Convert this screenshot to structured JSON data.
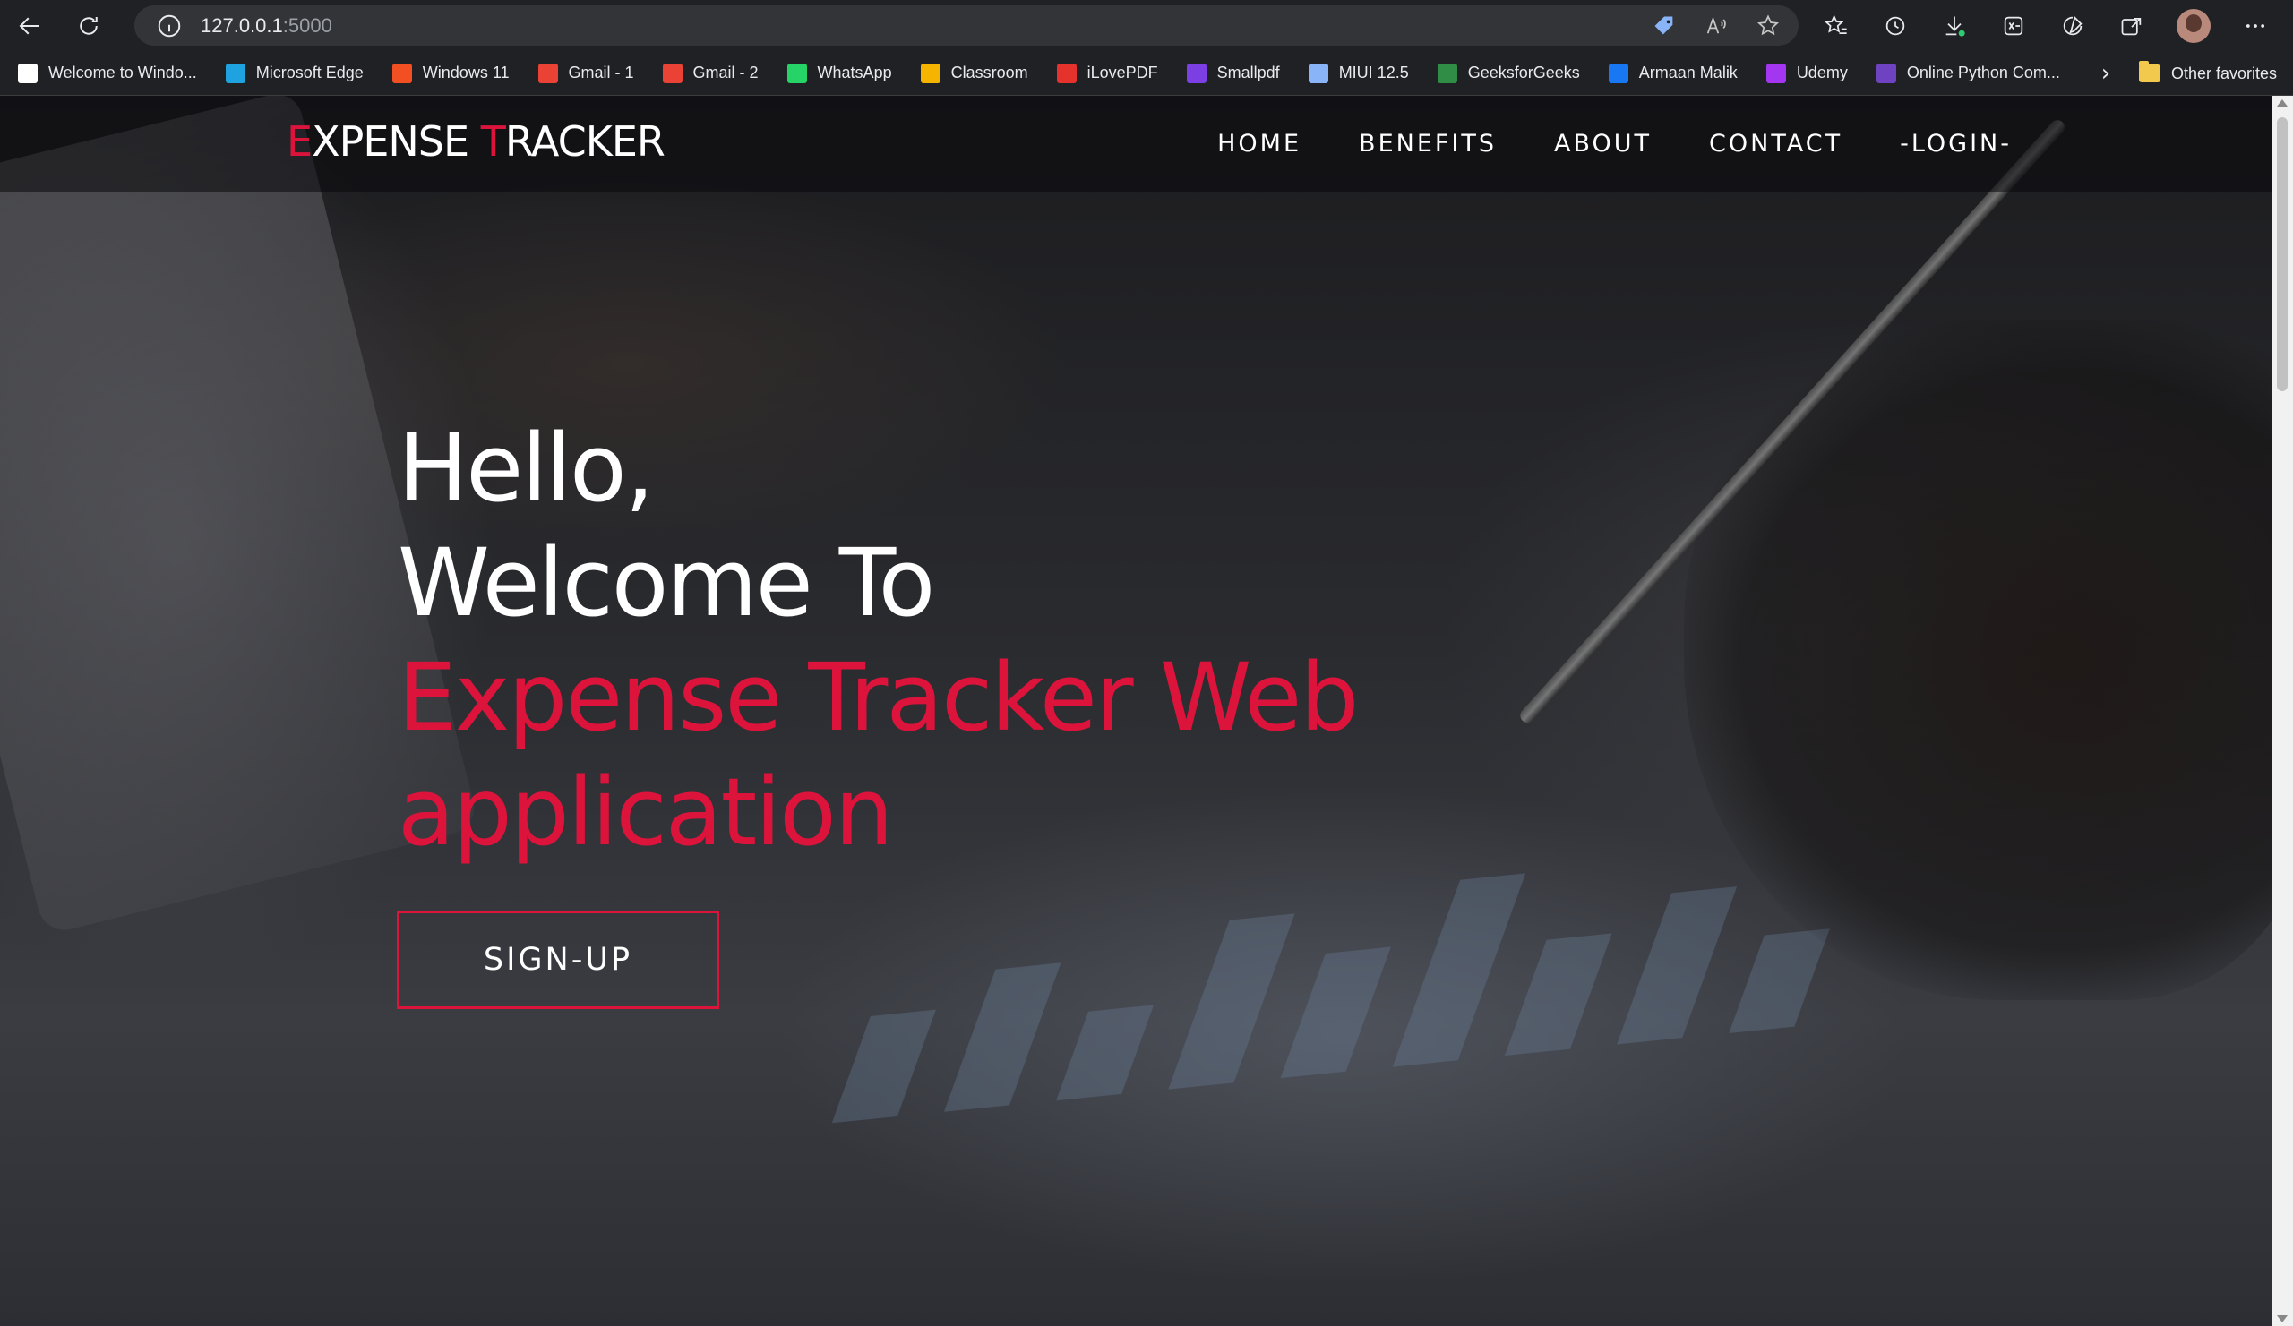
{
  "browser": {
    "url_host": "127.0.0.1",
    "url_port": ":5000",
    "bookmarks": [
      {
        "label": "Welcome to Windo...",
        "icon": "window-icon",
        "color": "#ffffff"
      },
      {
        "label": "Microsoft Edge",
        "icon": "edge-icon",
        "color": "#1fa2e0"
      },
      {
        "label": "Windows 11",
        "icon": "windows-icon",
        "color": "#f25022"
      },
      {
        "label": "Gmail - 1",
        "icon": "gmail-icon",
        "color": "#ea4335"
      },
      {
        "label": "Gmail - 2",
        "icon": "gmail-icon",
        "color": "#ea4335"
      },
      {
        "label": "WhatsApp",
        "icon": "whatsapp-icon",
        "color": "#25d366"
      },
      {
        "label": "Classroom",
        "icon": "classroom-icon",
        "color": "#f4b400"
      },
      {
        "label": "iLovePDF",
        "icon": "ilovepdf-icon",
        "color": "#e5322d"
      },
      {
        "label": "Smallpdf",
        "icon": "smallpdf-icon",
        "color": "#7b3fe4"
      },
      {
        "label": "MIUI 12.5",
        "icon": "miui-icon",
        "color": "#8ab4f8"
      },
      {
        "label": "GeeksforGeeks",
        "icon": "geeksforgeeks-icon",
        "color": "#2f8d46"
      },
      {
        "label": "Armaan Malik",
        "icon": "facebook-icon",
        "color": "#1877f2"
      },
      {
        "label": "Udemy",
        "icon": "udemy-icon",
        "color": "#a435f0"
      },
      {
        "label": "Online Python Com...",
        "icon": "python-icon",
        "color": "#6f42c1"
      }
    ],
    "other_favorites": "Other favorites"
  },
  "site": {
    "logo_first_initial": "E",
    "logo_first_rest": "XPENSE ",
    "logo_second_initial": "T",
    "logo_second_rest": "RACKER",
    "nav": [
      "HOME",
      "BENEFITS",
      "ABOUT",
      "CONTACT",
      "-LOGIN-"
    ],
    "hero_line1": "Hello,",
    "hero_line2": "Welcome To",
    "hero_line3": "Expense Tracker Web",
    "hero_line4": "application",
    "signup_label": "SIGN-UP",
    "accent_color": "#dc143c"
  }
}
